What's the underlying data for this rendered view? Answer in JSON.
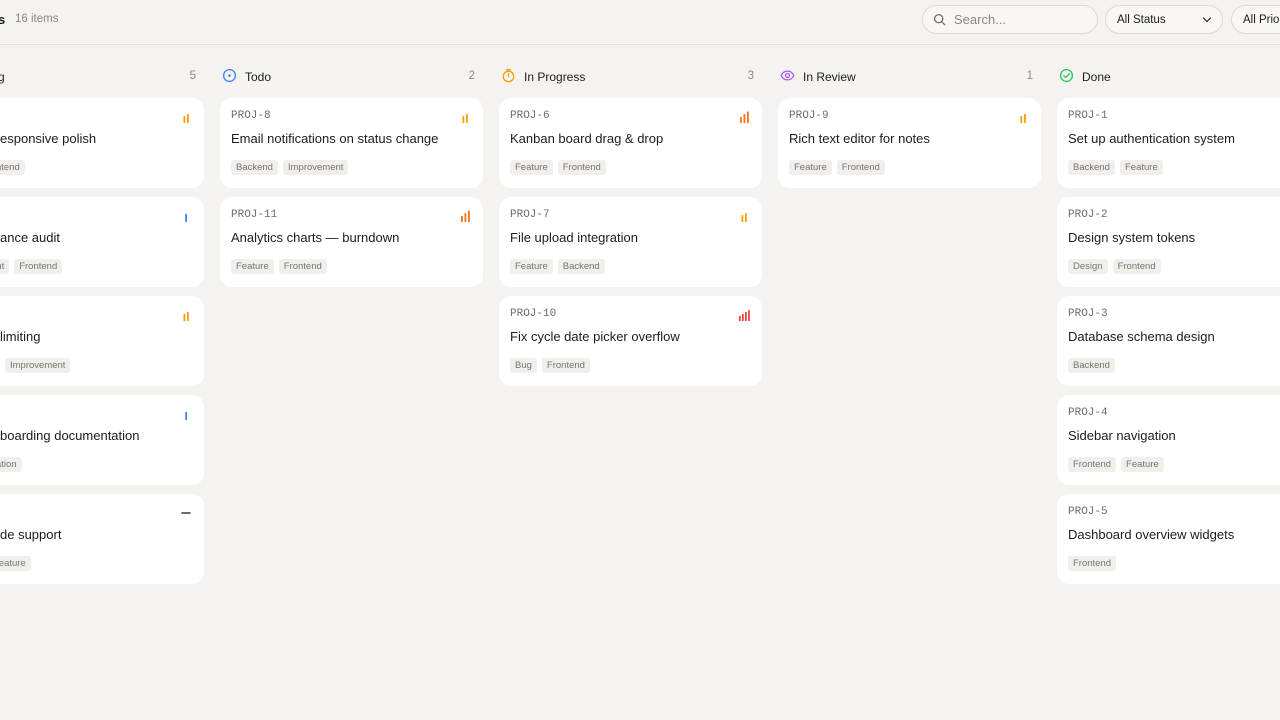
{
  "header": {
    "title": "s",
    "item_count": "16 items",
    "search_placeholder": "Search...",
    "status_filter": "All Status",
    "priority_filter": "All Priori"
  },
  "colors": {
    "accent_todo": "#3b82f6",
    "accent_progress": "#f59e0b",
    "accent_review": "#a855f7",
    "accent_done": "#22c55e",
    "priority_high": "#f97316",
    "priority_medium": "#f59e0b",
    "priority_low": "#3b82f6",
    "priority_urgent": "#ef4444"
  },
  "columns": [
    {
      "key": "backlog",
      "title": "g",
      "count": "5",
      "icon": "backlog-icon",
      "cards": [
        {
          "id": "",
          "title": "esponsive polish",
          "priority": "medium",
          "tags": [
            "ntend"
          ]
        },
        {
          "id": "",
          "title": "ance audit",
          "priority": "low",
          "tags": [
            "ent",
            "Frontend"
          ]
        },
        {
          "id": "",
          "title": "limiting",
          "priority": "medium",
          "tags": [
            "Improvement"
          ]
        },
        {
          "id": "",
          "title": "boarding documentation",
          "priority": "low",
          "tags": [
            "ation"
          ]
        },
        {
          "id": "",
          "title": "de support",
          "priority": "none",
          "tags": [
            "Feature"
          ]
        }
      ]
    },
    {
      "key": "todo",
      "title": "Todo",
      "count": "2",
      "icon": "todo-circle-icon",
      "cards": [
        {
          "id": "PROJ-8",
          "title": "Email notifications on status change",
          "priority": "medium",
          "tags": [
            "Backend",
            "Improvement"
          ]
        },
        {
          "id": "PROJ-11",
          "title": "Analytics charts — burndown",
          "priority": "high",
          "tags": [
            "Feature",
            "Frontend"
          ]
        }
      ]
    },
    {
      "key": "in-progress",
      "title": "In Progress",
      "count": "3",
      "icon": "timer-icon",
      "cards": [
        {
          "id": "PROJ-6",
          "title": "Kanban board drag & drop",
          "priority": "high",
          "tags": [
            "Feature",
            "Frontend"
          ]
        },
        {
          "id": "PROJ-7",
          "title": "File upload integration",
          "priority": "medium",
          "tags": [
            "Feature",
            "Backend"
          ]
        },
        {
          "id": "PROJ-10",
          "title": "Fix cycle date picker overflow",
          "priority": "urgent",
          "tags": [
            "Bug",
            "Frontend"
          ]
        }
      ]
    },
    {
      "key": "in-review",
      "title": "In Review",
      "count": "1",
      "icon": "eye-icon",
      "cards": [
        {
          "id": "PROJ-9",
          "title": "Rich text editor for notes",
          "priority": "medium",
          "tags": [
            "Feature",
            "Frontend"
          ]
        }
      ]
    },
    {
      "key": "done",
      "title": "Done",
      "count": "",
      "icon": "check-circle-icon",
      "cards": [
        {
          "id": "PROJ-1",
          "title": "Set up authentication system",
          "priority": "none",
          "tags": [
            "Backend",
            "Feature"
          ]
        },
        {
          "id": "PROJ-2",
          "title": "Design system tokens",
          "priority": "none",
          "tags": [
            "Design",
            "Frontend"
          ]
        },
        {
          "id": "PROJ-3",
          "title": "Database schema design",
          "priority": "none",
          "tags": [
            "Backend"
          ]
        },
        {
          "id": "PROJ-4",
          "title": "Sidebar navigation",
          "priority": "none",
          "tags": [
            "Frontend",
            "Feature"
          ]
        },
        {
          "id": "PROJ-5",
          "title": "Dashboard overview widgets",
          "priority": "none",
          "tags": [
            "Frontend"
          ]
        }
      ]
    }
  ]
}
